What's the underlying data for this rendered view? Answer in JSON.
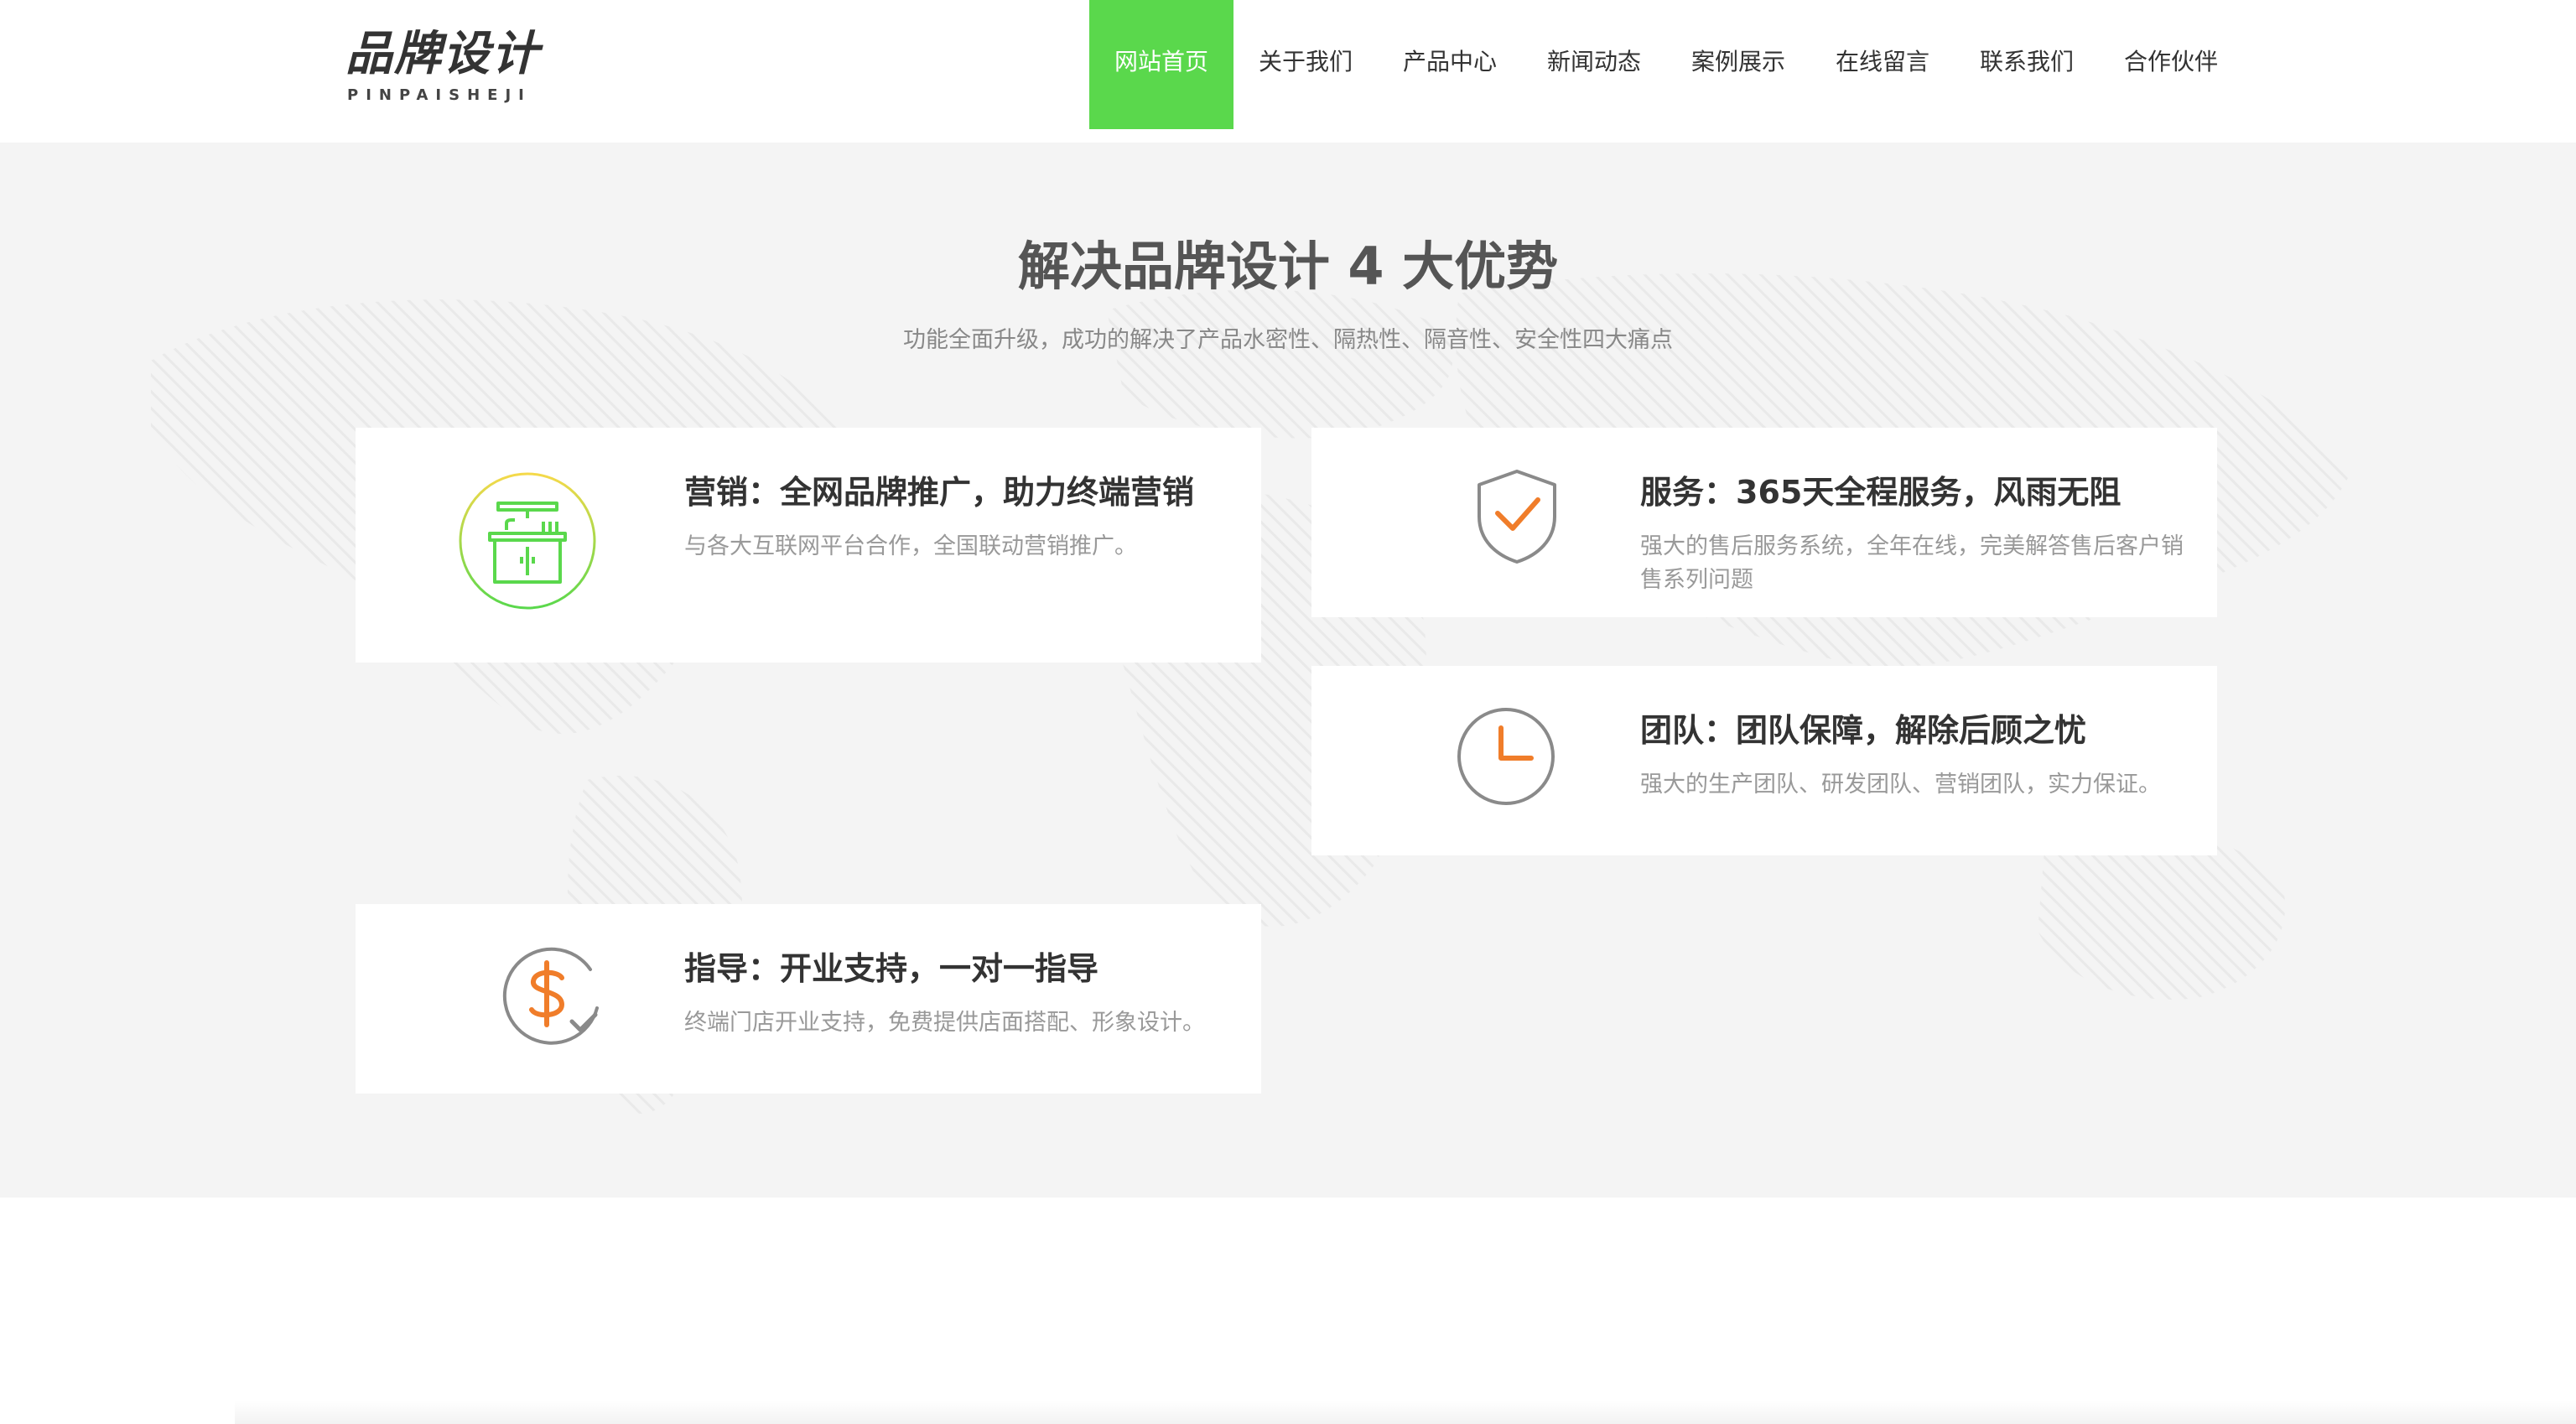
{
  "header": {
    "logo_cn": "品牌设计",
    "logo_en": "PINPAISHEJI",
    "nav": [
      {
        "label": "网站首页",
        "active": true
      },
      {
        "label": "关于我们",
        "active": false
      },
      {
        "label": "产品中心",
        "active": false
      },
      {
        "label": "新闻动态",
        "active": false
      },
      {
        "label": "案例展示",
        "active": false
      },
      {
        "label": "在线留言",
        "active": false
      },
      {
        "label": "联系我们",
        "active": false
      },
      {
        "label": "合作伙伴",
        "active": false
      }
    ]
  },
  "section": {
    "title": "解决品牌设计 4 大优势",
    "subtitle": "功能全面升级，成功的解决了产品水密性、隔热性、隔音性、安全性四大痛点",
    "cards": [
      {
        "title": "营销：全网品牌推广，助力终端营销",
        "desc": "与各大互联网平台合作，全国联动营销推广。",
        "icon": "kitchen-cabinet-icon"
      },
      {
        "title": "服务：365天全程服务，风雨无阻",
        "desc": "强大的售后服务系统，全年在线，完美解答售后客户销售系列问题",
        "icon": "shield-check-icon"
      },
      {
        "title": "团队：团队保障，解除后顾之忧",
        "desc": "强大的生产团队、研发团队、营销团队，实力保证。",
        "icon": "clock-icon"
      },
      {
        "title": "指导：开业支持，一对一指导",
        "desc": "终端门店开业支持，免费提供店面搭配、形象设计。",
        "icon": "dollar-check-icon"
      }
    ]
  },
  "colors": {
    "accent": "#5ad84c",
    "icon_orange": "#f07d2a",
    "icon_gray": "#8a8a8a",
    "section_bg": "#f4f4f4"
  }
}
